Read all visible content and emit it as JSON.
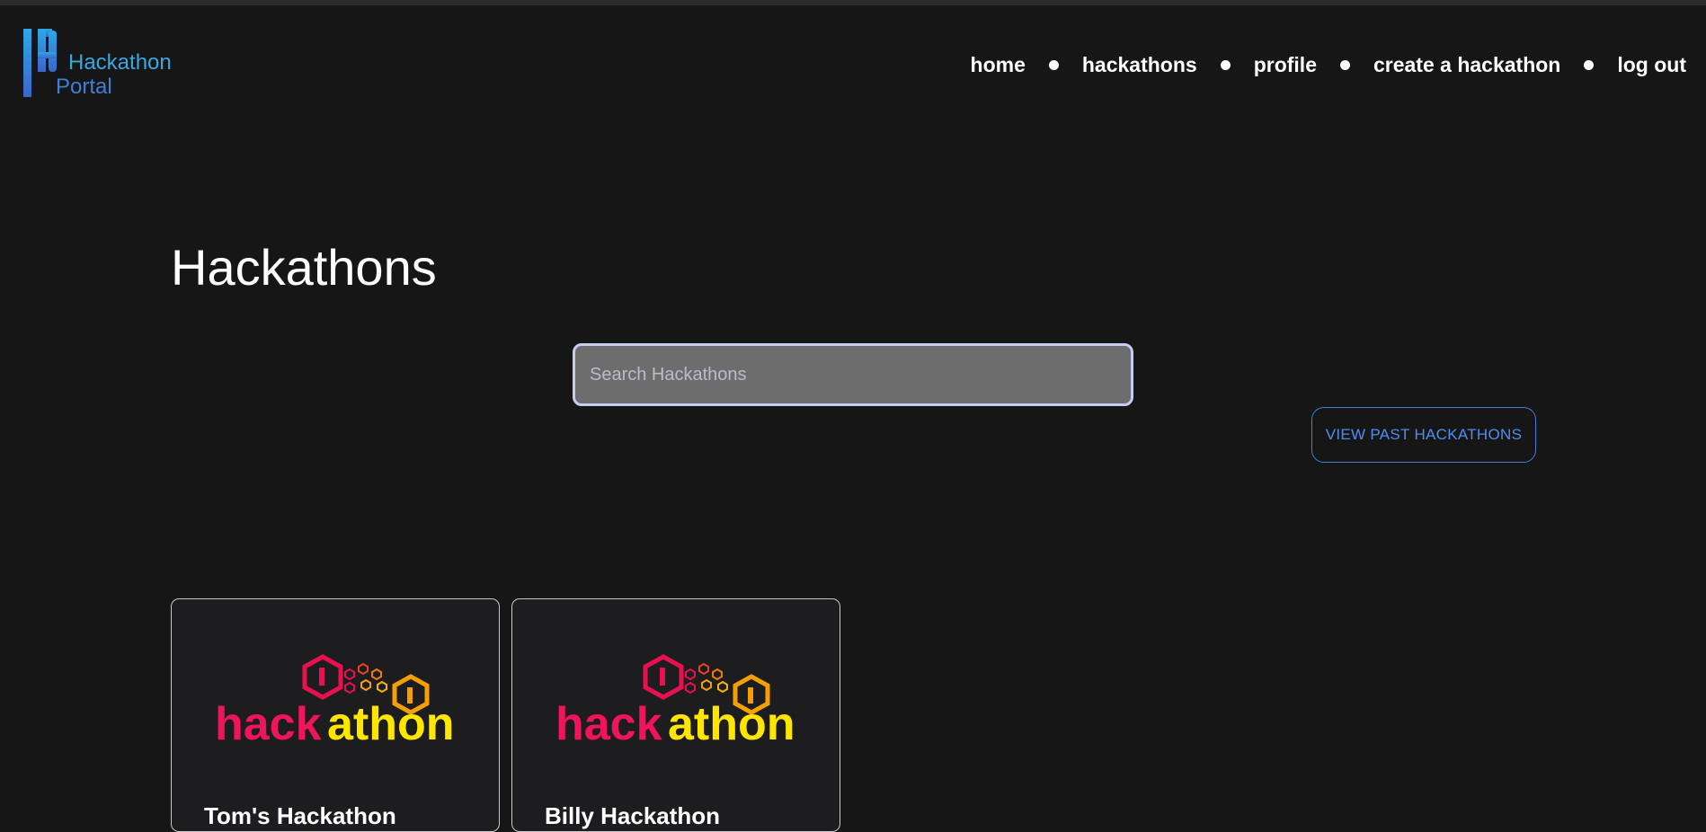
{
  "app": {
    "logo": {
      "line1": "Hackathon",
      "line2": "Portal",
      "icon": "hackathon-portal-logo-icon"
    }
  },
  "nav": {
    "items": [
      {
        "label": "home"
      },
      {
        "label": "hackathons"
      },
      {
        "label": "profile"
      },
      {
        "label": "create a hackathon"
      },
      {
        "label": "log out"
      }
    ]
  },
  "main": {
    "title": "Hackathons",
    "search": {
      "placeholder": "Search Hackathons",
      "value": ""
    },
    "past_button_label": "VIEW PAST HACKATHONS",
    "cards": [
      {
        "image_text_1": "hack",
        "image_text_2": "athon",
        "title": "Tom's Hackathon"
      },
      {
        "image_text_1": "hack",
        "image_text_2": "athon",
        "title": "Billy Hackathon"
      }
    ]
  },
  "colors": {
    "background": "#161616",
    "accent_blue": "#4f8ef0",
    "card_bg": "#1d1d20",
    "logo_pink": "#f0145a",
    "logo_yellow": "#ffe600",
    "logo_orange": "#f5a000"
  }
}
